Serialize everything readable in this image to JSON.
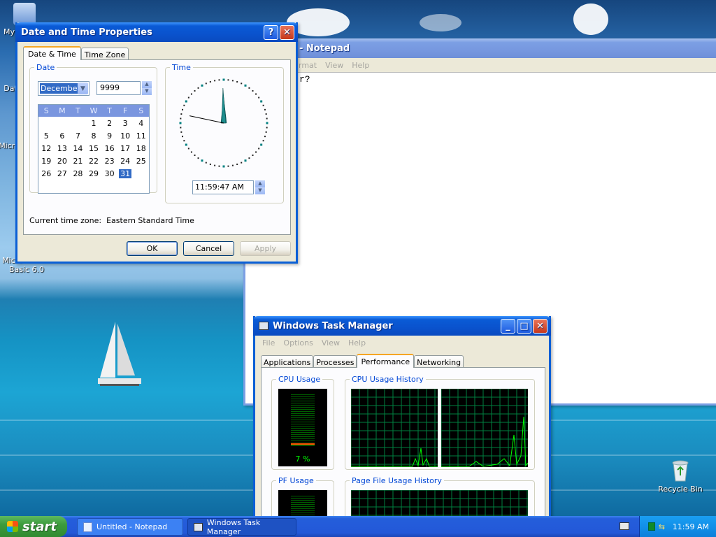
{
  "desktop": {
    "icons": [
      {
        "label": "My"
      },
      {
        "label": "Dat"
      },
      {
        "label": "Micro"
      },
      {
        "label": "C"
      },
      {
        "label": "Micro"
      },
      {
        "label": "Basic 6.0"
      },
      {
        "label": "Recycle Bin"
      }
    ]
  },
  "datetime_dialog": {
    "title": "Date and Time Properties",
    "tabs": [
      "Date & Time",
      "Time Zone"
    ],
    "date_group": "Date",
    "month": "December",
    "year": "9999",
    "weekdays": [
      "S",
      "M",
      "T",
      "W",
      "T",
      "F",
      "S"
    ],
    "weeks": [
      [
        "",
        "",
        "",
        "1",
        "2",
        "3",
        "4"
      ],
      [
        "5",
        "6",
        "7",
        "8",
        "9",
        "10",
        "11"
      ],
      [
        "12",
        "13",
        "14",
        "15",
        "16",
        "17",
        "18"
      ],
      [
        "19",
        "20",
        "21",
        "22",
        "23",
        "24",
        "25"
      ],
      [
        "26",
        "27",
        "28",
        "29",
        "30",
        "31",
        ""
      ]
    ],
    "selected_day": "31",
    "time_group": "Time",
    "time": "11:59:47 AM",
    "timezone_label": "Current time zone:",
    "timezone": "Eastern Standard Time",
    "buttons": {
      "ok": "OK",
      "cancel": "Cancel",
      "apply": "Apply"
    }
  },
  "notepad": {
    "title_fragment": "- Notepad",
    "menu": [
      "rmat",
      "View",
      "Help"
    ],
    "text_fragment": "r?"
  },
  "taskmgr": {
    "title": "Windows Task Manager",
    "menu": [
      "File",
      "Options",
      "View",
      "Help"
    ],
    "tabs": [
      "Applications",
      "Processes",
      "Performance",
      "Networking"
    ],
    "active_tab": "Performance",
    "cpu_usage_label": "CPU Usage",
    "cpu_history_label": "CPU Usage History",
    "cpu_percent": "7 %",
    "cpu_value": 0.07,
    "pf_usage_label": "PF Usage",
    "pf_history_label": "Page File Usage History"
  },
  "taskbar": {
    "start": "start",
    "tasks": [
      "Untitled - Notepad",
      "Windows Task Manager"
    ],
    "clock": "11:59 AM"
  },
  "colors": {
    "xp_blue": "#0a5fd6",
    "graph_green": "#00ff00",
    "graph_grid": "#008040",
    "group_title": "#0046d5",
    "selected_day_bg": "#316ac5"
  }
}
